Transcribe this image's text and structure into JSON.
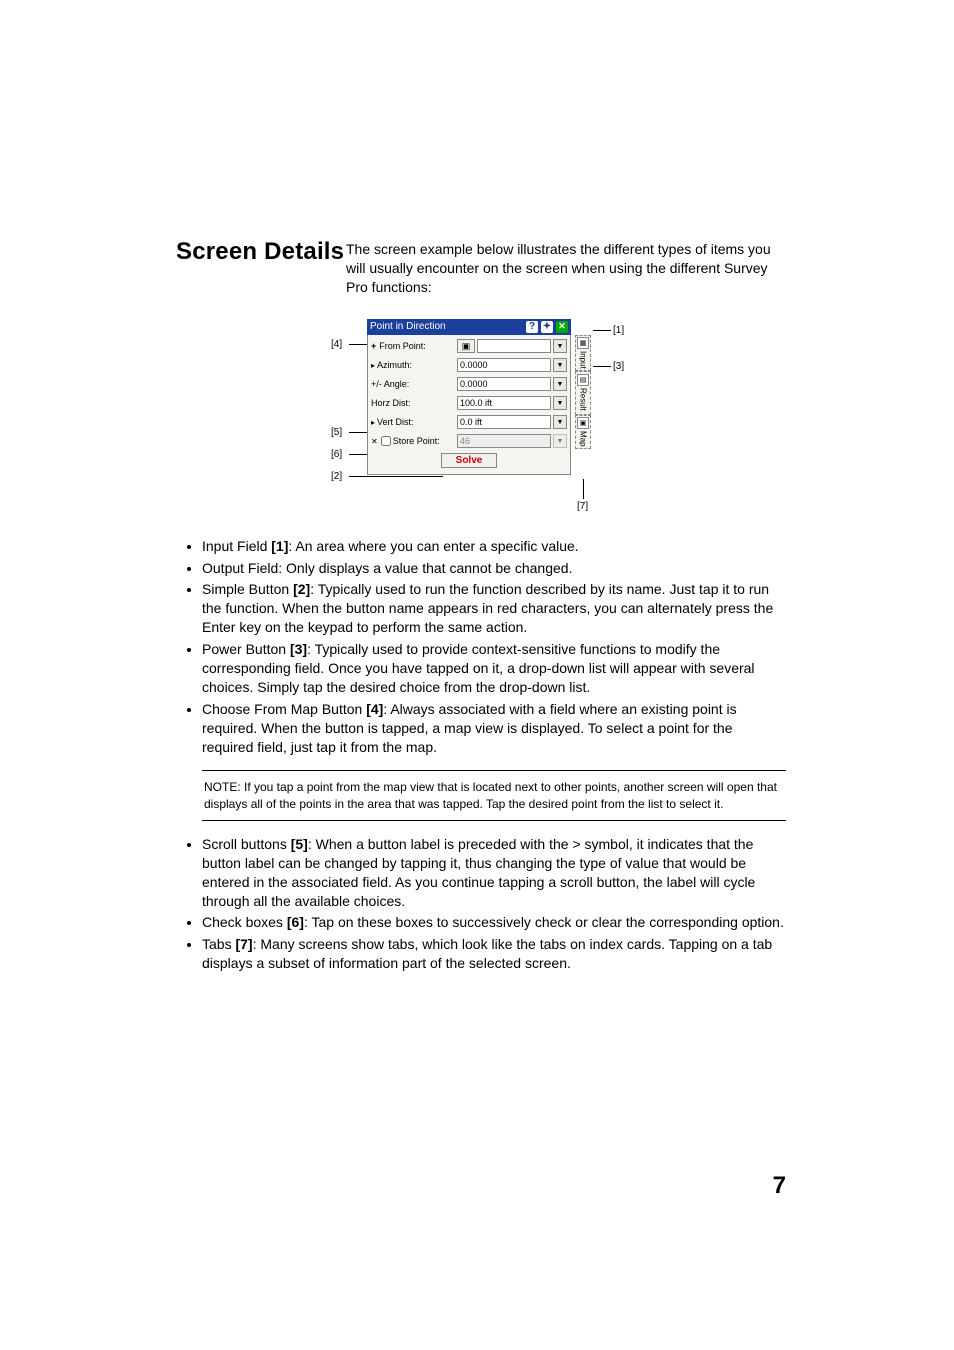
{
  "heading": "Screen Details",
  "intro": "The screen example below illustrates the different types of items you will usually encounter on the screen when using the different Survey Pro functions:",
  "figure": {
    "title": "Point in Direction",
    "rows": {
      "from_point_label": "From Point:",
      "from_point_value": "",
      "azimuth_label": "Azimuth:",
      "azimuth_value": "0.0000",
      "angle_label": "+/- Angle:",
      "angle_value": "0.0000",
      "horz_label": "Horz Dist:",
      "horz_value": "100.0 ift",
      "vert_label": "Vert Dist:",
      "vert_value": "0.0 ift",
      "store_label": "Store Point:",
      "store_value": "46"
    },
    "solve": "Solve",
    "tabs": {
      "input": "Input",
      "result": "Result",
      "map": "Map"
    },
    "callouts": {
      "c1": "[1]",
      "c2": "[2]",
      "c3": "[3]",
      "c4": "[4]",
      "c5": "[5]",
      "c6": "[6]",
      "c7": "[7]"
    }
  },
  "bullets1": [
    {
      "lead": "Input Field ",
      "ref": "[1]",
      "tail": ": An area where you can enter a specific value."
    },
    {
      "lead": "Output Field",
      "ref": "",
      "tail": ": Only displays a value that cannot be changed."
    },
    {
      "lead": "Simple Button ",
      "ref": "[2]",
      "tail": ": Typically used to run the function described by its name. Just tap it to run the function. When the button name appears in red characters, you can alternately press the Enter key on the keypad to perform the same action."
    },
    {
      "lead": "Power Button ",
      "ref": "[3]",
      "tail": ": Typically used to provide context-sensitive functions to modify the corresponding field. Once you have tapped on it, a drop-down list will appear with several choices. Simply tap the desired choice from the drop-down list."
    },
    {
      "lead": "Choose From Map Button ",
      "ref": "[4]",
      "tail": ": Always associated with a field where an existing point is required. When the button is tapped, a map view is displayed. To select a point for the required field, just tap it from the map."
    }
  ],
  "note": "NOTE: If you tap a point from the map view that is located next to other points, another screen will open that displays all of the points in the area that was tapped. Tap the desired point from the list to select it.",
  "bullets2": [
    {
      "lead": "Scroll buttons ",
      "ref": "[5]",
      "tail": ": When a button label is preceded with the > symbol, it indicates that the button label can be changed by tapping it, thus changing the type of value that would be entered in the associated field. As you continue tapping a scroll button, the label will cycle through all the available choices."
    },
    {
      "lead": "Check boxes ",
      "ref": "[6]",
      "tail": ": Tap on these boxes to successively check or clear the corresponding option."
    },
    {
      "lead": "Tabs ",
      "ref": "[7]",
      "tail": ": Many screens show tabs, which look like the tabs on index cards. Tapping on a tab displays a subset of information part of the selected screen."
    }
  ],
  "page_num": "7"
}
